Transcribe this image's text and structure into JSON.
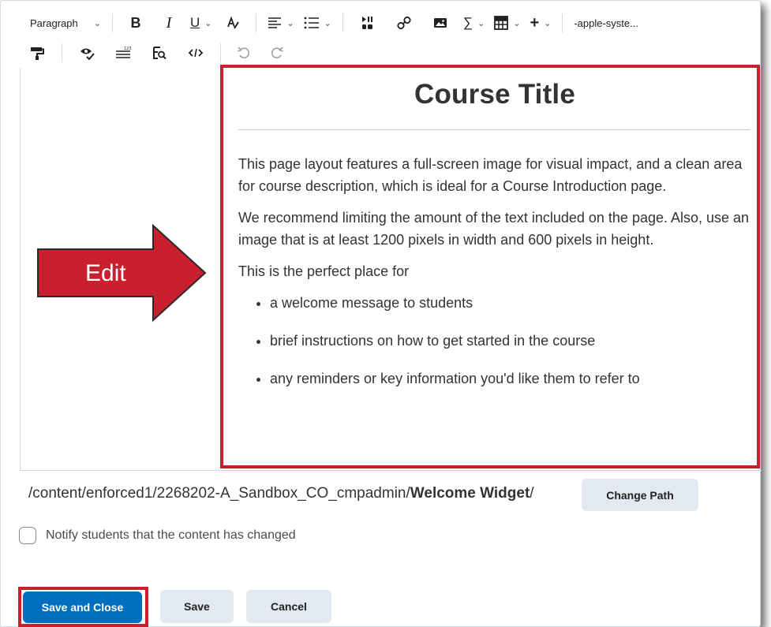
{
  "toolbar": {
    "block_format": "Paragraph",
    "font_family": "-apple-syste...",
    "icons": [
      "bold-icon",
      "italic-icon",
      "underline-icon",
      "text-color-icon",
      "align-icon",
      "list-icon",
      "insert-stuff-icon",
      "link-icon",
      "image-icon",
      "equation-icon",
      "table-icon",
      "insert-more-icon",
      "format-painter-icon",
      "accessibility-checker-icon",
      "word-count-icon",
      "find-replace-icon",
      "source-code-icon",
      "undo-icon",
      "redo-icon"
    ],
    "bold_glyph": "B",
    "italic_glyph": "I",
    "underline_glyph": "U",
    "equation_glyph": "∑",
    "plus_glyph": "+"
  },
  "content": {
    "title": "Course Title",
    "paragraphs": [
      "This page layout features a full-screen image for visual impact, and a clean area for course description, which is ideal for a Course Introduction page.",
      "We recommend limiting the amount of the text included on the page. Also, use an image that is at least 1200 pixels in width and 600 pixels in height.",
      "This is the perfect place for"
    ],
    "bullets": [
      "a welcome message to students",
      "brief instructions on how to get started in the course",
      "any reminders or key information you'd like them to refer to"
    ]
  },
  "annotation": {
    "arrow_label": "Edit",
    "color": "#c8202e"
  },
  "path": {
    "prefix": "/content/enforced1/2268202-A_Sandbox_CO_cmpadmin/",
    "folder": "Welcome Widget",
    "suffix": "/",
    "change_button": "Change Path"
  },
  "notify": {
    "label": "Notify students that the content has changed",
    "checked": false
  },
  "actions": {
    "save_close": "Save and Close",
    "save": "Save",
    "cancel": "Cancel"
  },
  "colors": {
    "primary": "#006fbf",
    "secondary": "#e3e9f1",
    "highlight": "#c8202e"
  }
}
